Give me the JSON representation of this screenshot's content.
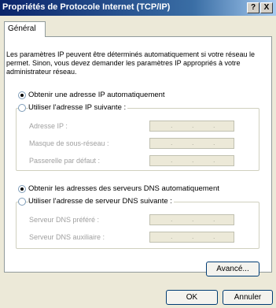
{
  "window": {
    "title": "Propriétés de Protocole Internet (TCP/IP)",
    "help_label": "?",
    "close_label": "X"
  },
  "tab": {
    "label": "Général"
  },
  "description": "Les paramètres IP peuvent être déterminés automatiquement si votre réseau le permet. Sinon, vous devez demander les paramètres IP appropriés à votre administrateur réseau.",
  "ip": {
    "auto_label": "Obtenir une adresse IP automatiquement",
    "manual_label": "Utiliser l'adresse IP suivante :",
    "auto_selected": true,
    "fields": [
      {
        "label": "Adresse IP :",
        "value": ""
      },
      {
        "label": "Masque de sous-réseau :",
        "value": ""
      },
      {
        "label": "Passerelle par défaut :",
        "value": ""
      }
    ]
  },
  "dns": {
    "auto_label": "Obtenir les adresses des serveurs DNS automatiquement",
    "manual_label": "Utiliser l'adresse de serveur DNS suivante :",
    "auto_selected": true,
    "fields": [
      {
        "label": "Serveur DNS préféré :",
        "value": ""
      },
      {
        "label": "Serveur DNS auxiliaire :",
        "value": ""
      }
    ]
  },
  "buttons": {
    "advanced": "Avancé...",
    "ok": "OK",
    "cancel": "Annuler"
  },
  "ip_separator": "."
}
